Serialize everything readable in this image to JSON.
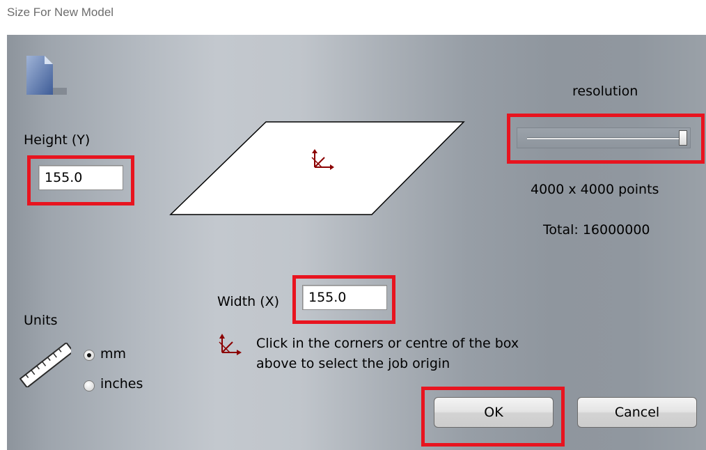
{
  "window": {
    "title": "Size For New Model"
  },
  "height": {
    "label": "Height (Y)",
    "value": "155.0"
  },
  "width": {
    "label": "Width (X)",
    "value": "155.0"
  },
  "resolution": {
    "label": "resolution",
    "slider_value_fraction": 1.0,
    "points_text": "4000 x 4000 points",
    "total_text": "Total: 16000000"
  },
  "units": {
    "label": "Units",
    "options": [
      {
        "label": "mm",
        "selected": true
      },
      {
        "label": "inches",
        "selected": false
      }
    ]
  },
  "hint": {
    "line1": "Click in the corners or centre of the box",
    "line2": "above to select the job origin"
  },
  "buttons": {
    "ok": "OK",
    "cancel": "Cancel"
  },
  "colors": {
    "highlight": "#e8141f",
    "origin_marker": "#8b0000"
  },
  "icons": [
    "document-icon",
    "origin-marker-icon",
    "ruler-icon"
  ]
}
